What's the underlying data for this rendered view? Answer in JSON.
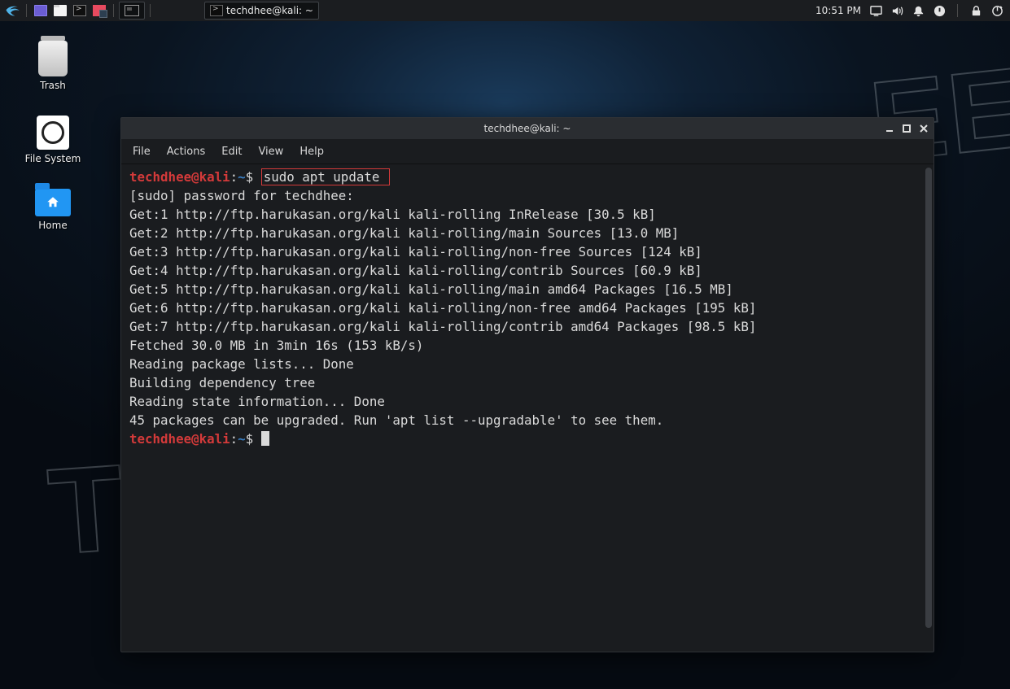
{
  "panel": {
    "task_title": "techdhee@kali: ~",
    "clock": "10:51 PM"
  },
  "desktop": {
    "trash": "Trash",
    "filesystem": "File System",
    "home": "Home"
  },
  "terminal": {
    "title": "techdhee@kali: ~",
    "menu": {
      "file": "File",
      "actions": "Actions",
      "edit": "Edit",
      "view": "View",
      "help": "Help"
    },
    "prompt": {
      "user": "techdhee@kali",
      "sep1": ":",
      "path": "~",
      "sep2": "$"
    },
    "command": "sudo apt update",
    "output": [
      "[sudo] password for techdhee:",
      "Get:1 http://ftp.harukasan.org/kali kali-rolling InRelease [30.5 kB]",
      "Get:2 http://ftp.harukasan.org/kali kali-rolling/main Sources [13.0 MB]",
      "Get:3 http://ftp.harukasan.org/kali kali-rolling/non-free Sources [124 kB]",
      "Get:4 http://ftp.harukasan.org/kali kali-rolling/contrib Sources [60.9 kB]",
      "Get:5 http://ftp.harukasan.org/kali kali-rolling/main amd64 Packages [16.5 MB]",
      "Get:6 http://ftp.harukasan.org/kali kali-rolling/non-free amd64 Packages [195 kB]",
      "Get:7 http://ftp.harukasan.org/kali kali-rolling/contrib amd64 Packages [98.5 kB]",
      "Fetched 30.0 MB in 3min 16s (153 kB/s)",
      "Reading package lists... Done",
      "Building dependency tree",
      "Reading state information... Done",
      "45 packages can be upgraded. Run 'apt list --upgradable' to see them."
    ]
  },
  "watermark": {
    "part1": "T",
    "part2": "EE"
  }
}
